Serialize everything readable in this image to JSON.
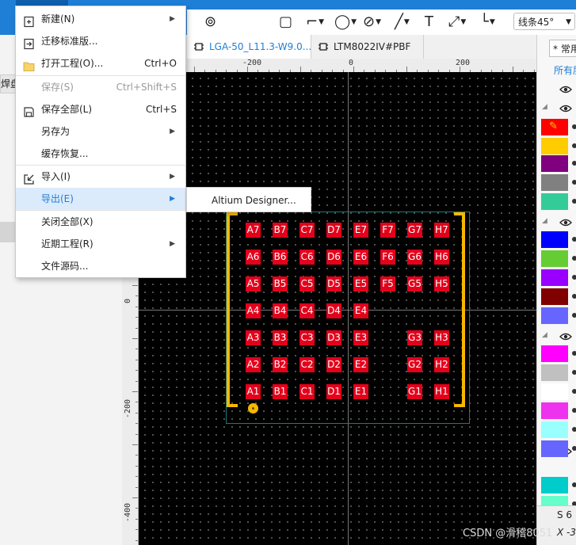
{
  "window": {
    "accent": "#1f7ed6",
    "menu_header_bg": "#0f5eab"
  },
  "toolbar": {
    "tools": [
      {
        "name": "via-tool",
        "glyph": "⊚",
        "caret": false
      },
      {
        "name": "text-block-tool",
        "glyph": "▢",
        "caret": false
      },
      {
        "name": "polygon-tool",
        "glyph": "⌐",
        "caret": true
      },
      {
        "name": "ellipse-tool",
        "glyph": "◯",
        "caret": true
      },
      {
        "name": "no-symbol-tool",
        "glyph": "⊘",
        "caret": true
      },
      {
        "name": "line-tool",
        "glyph": "╱",
        "caret": true
      },
      {
        "name": "text-tool",
        "glyph": "T",
        "caret": false
      },
      {
        "name": "measure-tool",
        "glyph": "⤢",
        "caret": true
      },
      {
        "name": "corner-tool",
        "glyph": "└",
        "caret": true
      }
    ],
    "line_mode": "线条45°"
  },
  "left_panel": {
    "tab_label": "焊盘"
  },
  "tabs": [
    {
      "label": "LGA-50_L11.3-W9.0...",
      "active": true
    },
    {
      "label": "LTM8022IV#PBF",
      "active": false
    }
  ],
  "ruler": {
    "top_labels": [
      "-200",
      "0",
      "200"
    ],
    "left_labels": [
      "0",
      "-200",
      "-400"
    ]
  },
  "file_menu": {
    "items": [
      {
        "label": "新建(N)",
        "shortcut": "",
        "submenu": true,
        "disabled": false,
        "icon": "new-file-icon"
      },
      {
        "label": "迁移标准版...",
        "shortcut": "",
        "submenu": false,
        "disabled": false,
        "icon": "migrate-icon"
      },
      {
        "label": "打开工程(O)...",
        "shortcut": "Ctrl+O",
        "submenu": false,
        "disabled": false,
        "icon": "folder-icon"
      },
      {
        "label": "保存(S)",
        "shortcut": "Ctrl+Shift+S",
        "submenu": false,
        "disabled": true,
        "icon": ""
      },
      {
        "label": "保存全部(L)",
        "shortcut": "Ctrl+S",
        "submenu": false,
        "disabled": false,
        "icon": "save-all-icon"
      },
      {
        "label": "另存为",
        "shortcut": "",
        "submenu": true,
        "disabled": false,
        "icon": ""
      },
      {
        "label": "缓存恢复...",
        "shortcut": "",
        "submenu": false,
        "disabled": false,
        "icon": ""
      },
      {
        "label": "导入(I)",
        "shortcut": "",
        "submenu": true,
        "disabled": false,
        "icon": "import-icon"
      },
      {
        "label": "导出(E)",
        "shortcut": "",
        "submenu": true,
        "disabled": false,
        "icon": "",
        "highlighted": true
      },
      {
        "label": "关闭全部(X)",
        "shortcut": "",
        "submenu": false,
        "disabled": false,
        "icon": ""
      },
      {
        "label": "近期工程(R)",
        "shortcut": "",
        "submenu": true,
        "disabled": false,
        "icon": ""
      },
      {
        "label": "文件源码...",
        "shortcut": "",
        "submenu": false,
        "disabled": false,
        "icon": ""
      }
    ],
    "export_submenu": [
      "Altium Designer..."
    ]
  },
  "footprint": {
    "pad_color": "#e3001b",
    "bracket_color": "#f5b800",
    "rows": [
      [
        "A7",
        "B7",
        "C7",
        "D7",
        "E7",
        "F7",
        "G7",
        "H7"
      ],
      [
        "A6",
        "B6",
        "C6",
        "D6",
        "E6",
        "F6",
        "G6",
        "H6"
      ],
      [
        "A5",
        "B5",
        "C5",
        "D5",
        "E5",
        "F5",
        "G5",
        "H5"
      ],
      [
        "A4",
        "B4",
        "C4",
        "D4",
        "E4",
        "",
        "",
        ""
      ],
      [
        "A3",
        "B3",
        "C3",
        "D3",
        "E3",
        "",
        "G3",
        "H3"
      ],
      [
        "A2",
        "B2",
        "C2",
        "D2",
        "E2",
        "",
        "G2",
        "H2"
      ],
      [
        "A1",
        "B1",
        "C1",
        "D1",
        "E1",
        "",
        "G1",
        "H1"
      ]
    ]
  },
  "right_panel": {
    "search_placeholder": "* 常用",
    "all_label": "所有层",
    "bottom_s": "S  6",
    "bottom_x": "X  -3",
    "layer_colors": [
      "#ff0000",
      "#ffcc00",
      "#800080",
      "#808080",
      "#33cc99",
      "#0000ff",
      "#66cc33",
      "#9900ff",
      "#800000",
      "#6666ff",
      "#ff00ff",
      "#c0c0c0",
      "#ffffff",
      "#ee33ee",
      "#99ffff",
      "#6666ff",
      "#00cccc",
      "#66ffcc"
    ]
  },
  "watermark": "CSDN @滑稽8051"
}
